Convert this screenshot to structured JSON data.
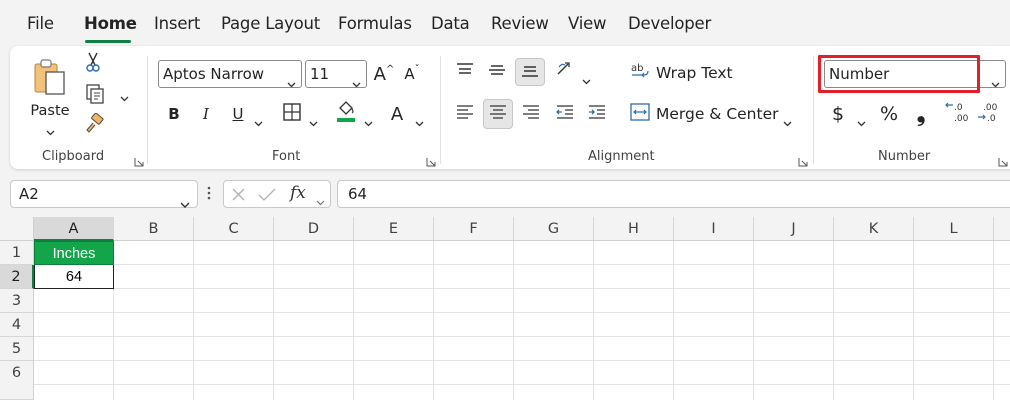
{
  "menu": {
    "tabs": [
      {
        "label": "File"
      },
      {
        "label": "Home"
      },
      {
        "label": "Insert"
      },
      {
        "label": "Page Layout"
      },
      {
        "label": "Formulas"
      },
      {
        "label": "Data"
      },
      {
        "label": "Review"
      },
      {
        "label": "View"
      },
      {
        "label": "Developer"
      }
    ],
    "active_tab": "Home"
  },
  "ribbon": {
    "clipboard": {
      "group_label": "Clipboard",
      "paste_label": "Paste"
    },
    "font": {
      "group_label": "Font",
      "font_name": "Aptos Narrow",
      "font_size": "11",
      "bold_label": "B",
      "italic_label": "I",
      "underline_label": "U",
      "grow_label": "A",
      "shrink_label": "A",
      "font_color_label": "A",
      "fill_color": "#12a54a"
    },
    "alignment": {
      "group_label": "Alignment",
      "wrap_text_label": "Wrap Text",
      "merge_center_label": "Merge & Center"
    },
    "number": {
      "group_label": "Number",
      "format_value": "Number",
      "currency_label": "$",
      "percent_label": "%",
      "comma_label": "❟"
    }
  },
  "formula_bar": {
    "name_box": "A2",
    "formula_value": "64",
    "fx_label": "fx"
  },
  "grid": {
    "columns": [
      "A",
      "B",
      "C",
      "D",
      "E",
      "F",
      "G",
      "H",
      "I",
      "J",
      "K",
      "L"
    ],
    "rows": [
      "1",
      "2",
      "3",
      "4",
      "5",
      "6"
    ],
    "cells": {
      "A1": "Inches",
      "A2": "64"
    },
    "header_fill": "#12a54a"
  },
  "colors": {
    "accent_green": "#117e43",
    "highlight_red": "#e3202a"
  }
}
